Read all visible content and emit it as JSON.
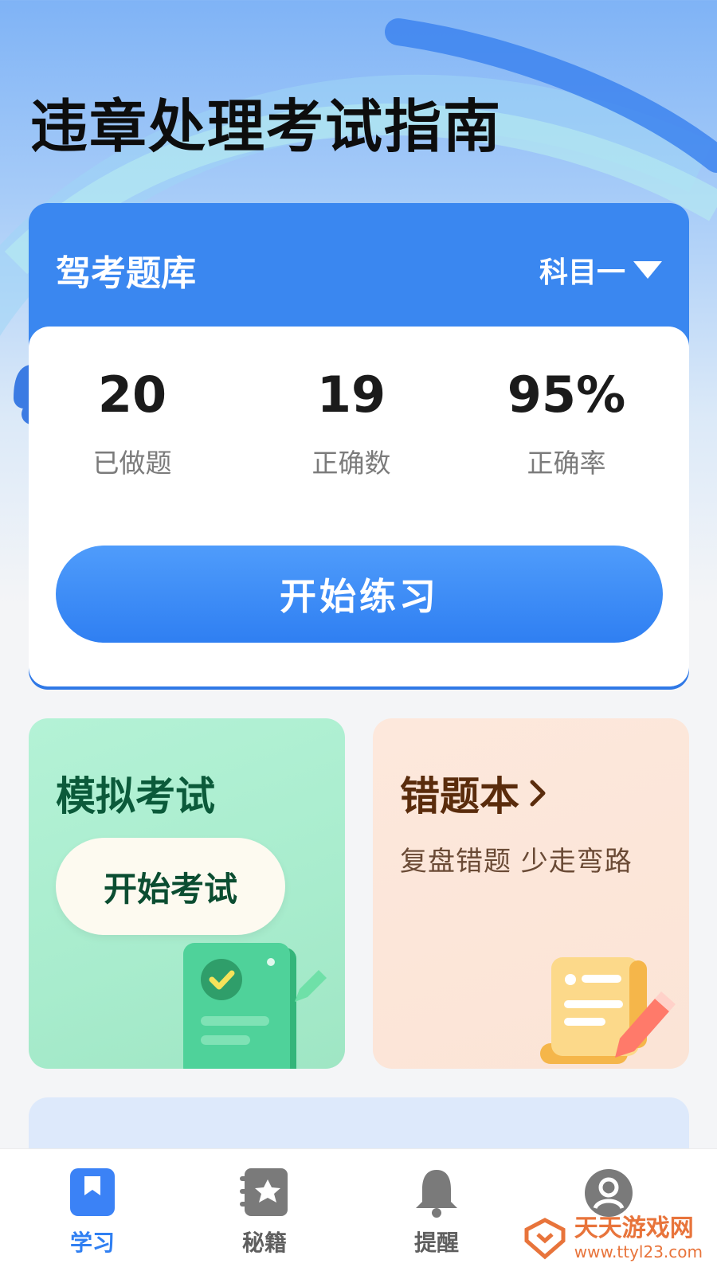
{
  "page": {
    "title": "违章处理考试指南"
  },
  "question_bank": {
    "title": "驾考题库",
    "subject": "科目一",
    "stats": [
      {
        "value": "20",
        "label": "已做题"
      },
      {
        "value": "19",
        "label": "正确数"
      },
      {
        "value": "95%",
        "label": "正确率"
      }
    ],
    "start_button": "开始练习"
  },
  "mock_exam": {
    "title": "模拟考试",
    "button": "开始考试"
  },
  "wrong_book": {
    "title": "错题本",
    "subtitle": "复盘错题 少走弯路"
  },
  "next_section": {
    "title": ""
  },
  "tabbar": {
    "items": [
      {
        "label": "学习",
        "icon": "bookmark-book-icon",
        "active": true
      },
      {
        "label": "秘籍",
        "icon": "star-notebook-icon",
        "active": false
      },
      {
        "label": "提醒",
        "icon": "bell-icon",
        "active": false
      },
      {
        "label": "",
        "icon": "user-avatar-icon",
        "active": false
      }
    ]
  },
  "watermark": {
    "brand": "天天游戏网",
    "url": "www.ttyl23.com"
  },
  "colors": {
    "primary": "#2f7ff2",
    "mock_bg": "#aeeecf",
    "wrong_bg": "#fce6d9"
  }
}
